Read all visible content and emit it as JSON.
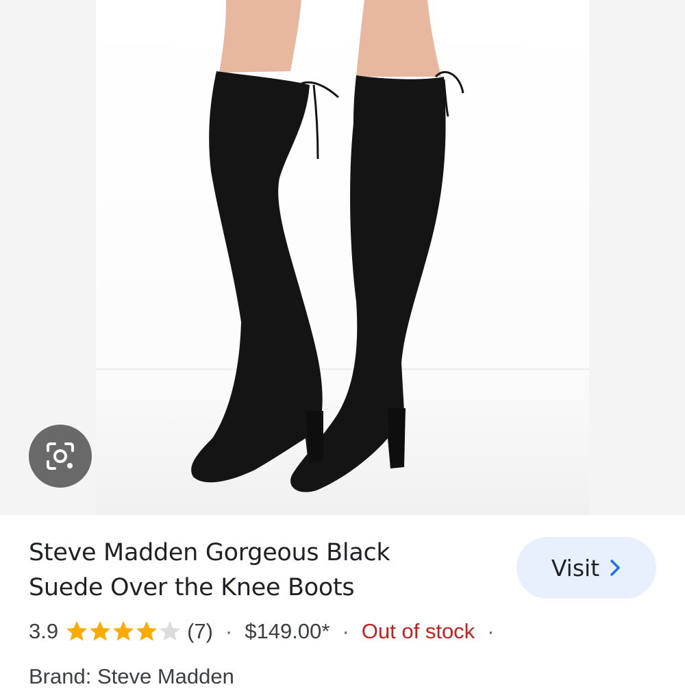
{
  "image": {
    "alt": "",
    "lens_icon": "camera-lens-icon"
  },
  "product": {
    "title_line1": "Steve Madden Gorgeous Black",
    "title_line2": "Suede Over the Knee Boots",
    "rating": "3.9",
    "rating_fraction": 0.78,
    "review_count": "(7)",
    "separator": "·",
    "price": "$149.00*",
    "stock_status": "Out of stock",
    "brand": "Brand: Steve Madden"
  },
  "visit_button": {
    "label": "Visit",
    "icon": "chevron-right-icon"
  },
  "colors": {
    "star": "#f9ab00",
    "star_empty": "#dadce0",
    "out_of_stock": "#c5221f",
    "visit_bg": "#e8f0fe",
    "visit_chevron": "#1a73e8"
  }
}
